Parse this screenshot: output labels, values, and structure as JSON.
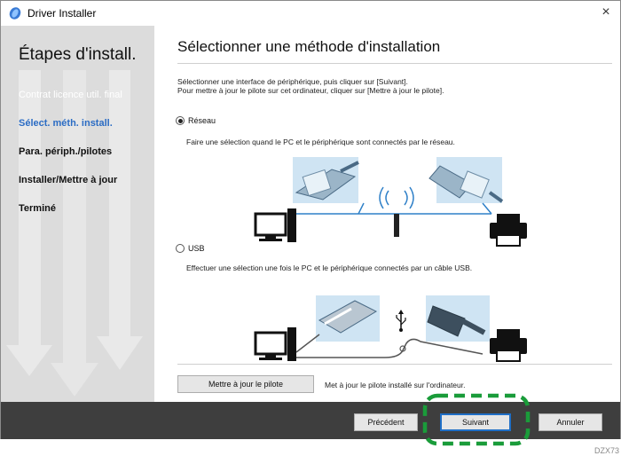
{
  "window": {
    "title": "Driver Installer",
    "close_glyph": "×"
  },
  "sidebar": {
    "heading": "Étapes d'install.",
    "steps": [
      {
        "label": "Contrat licence util. final",
        "state": "done"
      },
      {
        "label": "Sélect. méth. install.",
        "state": "current"
      },
      {
        "label": "Para. périph./pilotes",
        "state": "pending"
      },
      {
        "label": "Installer/Mettre à jour",
        "state": "pending"
      },
      {
        "label": "Terminé",
        "state": "pending"
      }
    ]
  },
  "main": {
    "title": "Sélectionner une méthode d'installation",
    "instruction_line1": "Sélectionner une interface de périphérique, puis cliquer sur [Suivant].",
    "instruction_line2": "Pour mettre à jour le pilote sur cet ordinateur, cliquer sur [Mettre à jour le pilote].",
    "options": [
      {
        "label": "Réseau",
        "selected": true,
        "description": "Faire une sélection quand le PC et le périphérique sont connectés par le réseau."
      },
      {
        "label": "USB",
        "selected": false,
        "description": "Effectuer une sélection une fois le PC et le périphérique connectés par un câble USB."
      }
    ],
    "update_button": "Mettre à jour le pilote",
    "update_description": "Met à jour le pilote installé sur l'ordinateur."
  },
  "footer": {
    "prev": "Précédent",
    "next": "Suivant",
    "cancel": "Annuler"
  },
  "caption": "DZX73",
  "colors": {
    "accent": "#2b6cc4",
    "highlight": "#1a9c3a",
    "cable_blue": "#2f80c8",
    "illus_bg": "#cfe4f3"
  }
}
